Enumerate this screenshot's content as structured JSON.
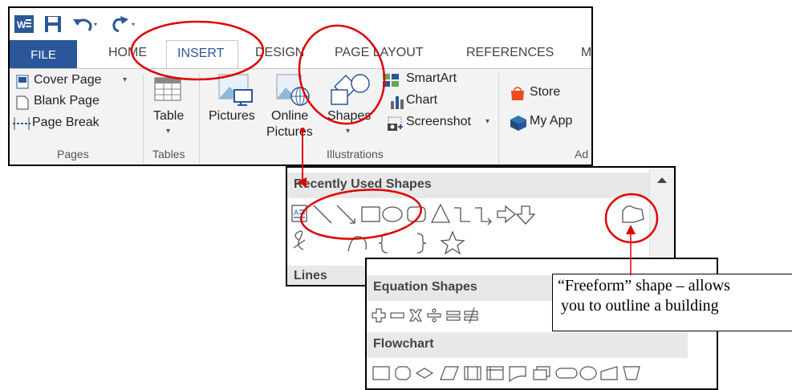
{
  "qat": {
    "word_icon": "word-app-icon",
    "save_icon": "save-icon",
    "undo_icon": "undo-icon",
    "redo_icon": "redo-icon"
  },
  "tabs": {
    "file": "FILE",
    "home": "HOME",
    "insert": "INSERT",
    "design": "DESIGN",
    "page_layout": "PAGE LAYOUT",
    "references": "REFERENCES",
    "more": "M"
  },
  "pages": {
    "cover": "Cover Page",
    "blank": "Blank Page",
    "break": "Page Break",
    "group": "Pages"
  },
  "tables": {
    "table": "Table",
    "group": "Tables"
  },
  "illustrations": {
    "pictures": "Pictures",
    "online1": "Online",
    "online2": "Pictures",
    "shapes": "Shapes",
    "smartart": "SmartArt",
    "chart": "Chart",
    "screenshot": "Screenshot",
    "group": "Illustrations"
  },
  "addins": {
    "store": "Store",
    "myapps": "My App",
    "group": "Ad"
  },
  "shapes_panel": {
    "recent": "Recently Used Shapes",
    "lines": "Lines"
  },
  "shapes_panel2": {
    "equation": "Equation Shapes",
    "flowchart": "Flowchart"
  },
  "callout": {
    "line1": "“Freeform” shape – allows",
    "line2": "you to outline a building"
  },
  "colors": {
    "file_tab": "#2b579a",
    "annotation_red": "#e00000",
    "ribbon_bg": "#f3f3f3"
  }
}
